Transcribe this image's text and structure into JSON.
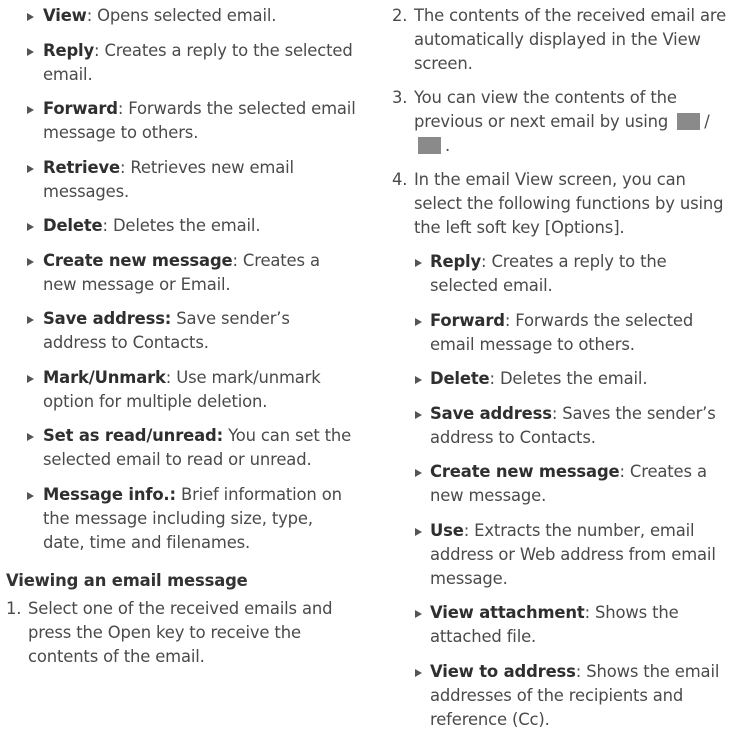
{
  "left": {
    "bullets": [
      {
        "term": "View",
        "text": ": Opens selected email."
      },
      {
        "term": "Reply",
        "text": ": Creates a reply to the selected email."
      },
      {
        "term": "Forward",
        "text": ": Forwards the selected email message to others."
      },
      {
        "term": "Retrieve",
        "text": ": Retrieves new email messages."
      },
      {
        "term": "Delete",
        "text": ": Deletes the email."
      },
      {
        "term": "Create new message",
        "text": ": Creates a new message or Email."
      },
      {
        "term": "Save address:",
        "text": " Save sender’s address to Contacts."
      },
      {
        "term": "Mark/Unmark",
        "text": ": Use mark/unmark option for multiple deletion."
      },
      {
        "term": "Set as read/unread:",
        "text": " You can set the selected email to read or unread."
      },
      {
        "term": "Message info.:",
        "text": " Brief information on the message including size, type, date, time and filenames."
      }
    ],
    "heading": "Viewing an email message",
    "step1_num": "1.",
    "step1": "Select one of the received emails and press the Open key to receive the contents of the email."
  },
  "right": {
    "step2_num": "2.",
    "step2": "The contents of the received email are automatically displayed in the View screen.",
    "step3_num": "3.",
    "step3_a": "You can view the contents of the previous or next email by using",
    "step3_sep": "/",
    "step3_end": ".",
    "step4_num": "4.",
    "step4": "In the email View screen, you can select the following functions by using the left soft key [Options].",
    "bullets": [
      {
        "term": "Reply",
        "text": ": Creates a reply to the selected email."
      },
      {
        "term": "Forward",
        "text": ": Forwards the selected email message to others."
      },
      {
        "term": "Delete",
        "text": ": Deletes the email."
      },
      {
        "term": "Save address",
        "text": ": Saves the sender’s address to Contacts."
      },
      {
        "term": "Create new message",
        "text": ": Creates a new message."
      },
      {
        "term": "Use",
        "text": ": Extracts the number, email address or Web address from email message."
      },
      {
        "term": "View attachment",
        "text": ": Shows the attached file."
      },
      {
        "term": "View to address",
        "text": ": Shows the email addresses of the recipients and reference (Cc)."
      }
    ]
  }
}
